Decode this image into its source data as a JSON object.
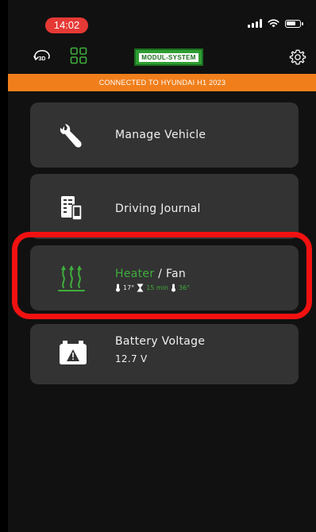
{
  "status_bar": {
    "time": "14:02",
    "icons": [
      "signal-icon",
      "wifi-icon",
      "battery-icon"
    ]
  },
  "topbar": {
    "view_3d_label": "3D",
    "logo_left": "MODUL",
    "logo_right": "SYSTEM",
    "icons": [
      "3d-view-icon",
      "grid-icon",
      "settings-gear-icon"
    ]
  },
  "banner": {
    "text": "CONNECTED TO HYUNDAI H1 2023"
  },
  "menu": {
    "manage_vehicle": {
      "title": "Manage Vehicle",
      "icon": "wrench-icon"
    },
    "driving_journal": {
      "title": "Driving Journal",
      "icon": "journal-icon"
    },
    "heater_fan": {
      "title_heater": "Heater",
      "title_separator": "/",
      "title_fan": "Fan",
      "icon": "heat-waves-icon",
      "inside_temp": "17°",
      "timer": "15 min",
      "target_temp": "36°"
    },
    "battery_voltage": {
      "title": "Battery Voltage",
      "value": "12.7 V",
      "icon": "car-battery-icon"
    }
  },
  "colors": {
    "background": "#111111",
    "card": "#333333",
    "banner": "#f07f1b",
    "accent_green": "#3fae3c",
    "highlight_red": "#f21111",
    "time_pill": "#e53935"
  }
}
